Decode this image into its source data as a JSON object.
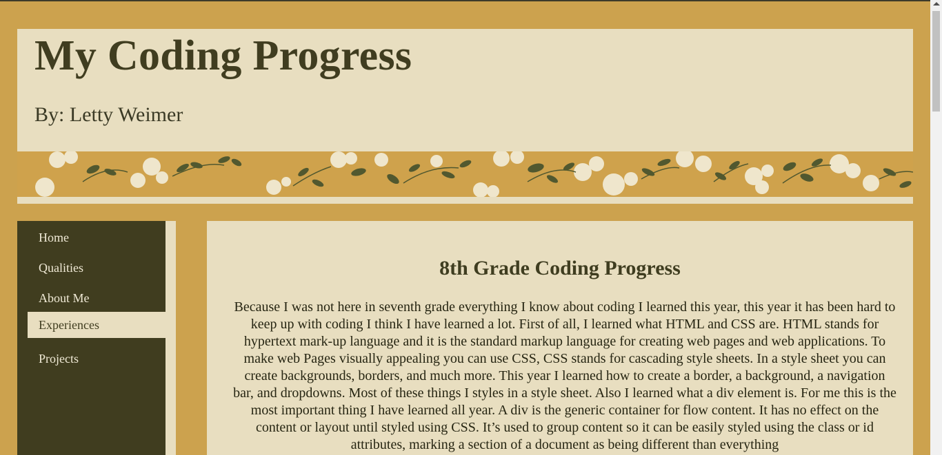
{
  "header": {
    "title": "My Coding Progress",
    "byline": "By: Letty Weimer"
  },
  "nav": {
    "items": [
      {
        "label": "Home",
        "active": false
      },
      {
        "label": "Qualities",
        "active": false
      },
      {
        "label": "About Me",
        "active": false
      },
      {
        "label": "Experiences",
        "active": true
      },
      {
        "label": "Projects",
        "active": false
      }
    ]
  },
  "main": {
    "heading": "8th Grade Coding Progress",
    "body": "Because I was not here in seventh grade everything I know about coding I learned this year, this year it has been hard to keep up with coding I think I have learned a lot. First of all, I learned what HTML and CSS are. HTML stands for hypertext mark-up language and it is the standard markup language for creating web pages and web applications. To make web Pages visually appealing you can use CSS, CSS stands for cascading style sheets. In a style sheet you can create backgrounds, borders, and much more. This year I learned how to create a border, a background, a navigation bar, and dropdowns. Most of these things I styles in a style sheet. Also I learned what a div element is. For me this is the most important thing I have learned all year. A div is the generic container for flow content. It has no effect on the content or layout until styled using CSS. It’s used to group content so it can be easily styled using the class or id attributes, marking a section of a document as being different than everything"
  },
  "colors": {
    "page_background": "#cca24e",
    "panel": "#e8dec0",
    "nav_background": "#403d1f",
    "title_text": "#403d20"
  },
  "banner": {
    "pattern": "floral-vine-pattern"
  }
}
